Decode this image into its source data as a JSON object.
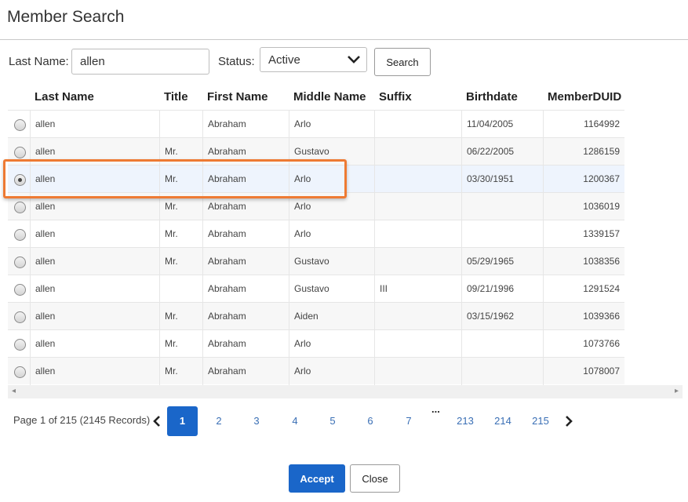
{
  "dialog": {
    "title": "Member Search"
  },
  "search": {
    "last_name_label": "Last Name:",
    "last_name_value": "allen",
    "status_label": "Status:",
    "status_value": "Active",
    "search_button": "Search"
  },
  "grid": {
    "columns": [
      "Last Name",
      "Title",
      "First Name",
      "Middle Name",
      "Suffix",
      "Birthdate",
      "MemberDUID"
    ],
    "selected_index": 2,
    "rows": [
      {
        "last": "allen",
        "title": "",
        "first": "Abraham",
        "middle": "Arlo",
        "suffix": "",
        "birth": "11/04/2005",
        "duid": "1164992"
      },
      {
        "last": "allen",
        "title": "Mr.",
        "first": "Abraham",
        "middle": "Gustavo",
        "suffix": "",
        "birth": "06/22/2005",
        "duid": "1286159"
      },
      {
        "last": "allen",
        "title": "Mr.",
        "first": "Abraham",
        "middle": "Arlo",
        "suffix": "",
        "birth": "03/30/1951",
        "duid": "1200367"
      },
      {
        "last": "allen",
        "title": "Mr.",
        "first": "Abraham",
        "middle": "Arlo",
        "suffix": "",
        "birth": "",
        "duid": "1036019"
      },
      {
        "last": "allen",
        "title": "Mr.",
        "first": "Abraham",
        "middle": "Arlo",
        "suffix": "",
        "birth": "",
        "duid": "1339157"
      },
      {
        "last": "allen",
        "title": "Mr.",
        "first": "Abraham",
        "middle": "Gustavo",
        "suffix": "",
        "birth": "05/29/1965",
        "duid": "1038356"
      },
      {
        "last": "allen",
        "title": "",
        "first": "Abraham",
        "middle": "Gustavo",
        "suffix": "III",
        "birth": "09/21/1996",
        "duid": "1291524"
      },
      {
        "last": "allen",
        "title": "Mr.",
        "first": "Abraham",
        "middle": "Aiden",
        "suffix": "",
        "birth": "03/15/1962",
        "duid": "1039366"
      },
      {
        "last": "allen",
        "title": "Mr.",
        "first": "Abraham",
        "middle": "Arlo",
        "suffix": "",
        "birth": "",
        "duid": "1073766"
      },
      {
        "last": "allen",
        "title": "Mr.",
        "first": "Abraham",
        "middle": "Arlo",
        "suffix": "",
        "birth": "",
        "duid": "1078007"
      }
    ]
  },
  "pager": {
    "info": "Page 1 of 215 (2145 Records)",
    "pages": [
      "1",
      "2",
      "3",
      "4",
      "5",
      "6",
      "7",
      "213",
      "214",
      "215"
    ],
    "ellipsis": "...",
    "current": "1"
  },
  "footer": {
    "accept": "Accept",
    "close": "Close"
  },
  "colors": {
    "accent": "#1a66c9",
    "highlight": "#ee7a33"
  }
}
